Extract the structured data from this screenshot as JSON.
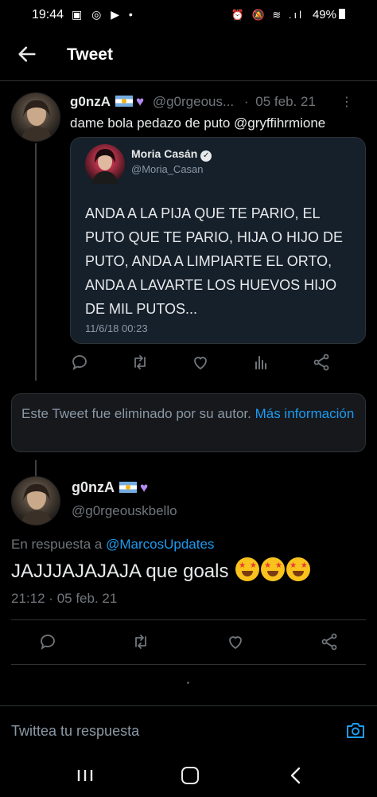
{
  "status_bar": {
    "time": "19:44",
    "notification_icons": "▣ ◎ ▶ •",
    "system_icons": "⏰ 🔕 ≋ .ıl",
    "battery": "49%"
  },
  "header": {
    "title": "Tweet"
  },
  "tweet1": {
    "name": "g0nzA",
    "handle": "@g0rgeous...",
    "separator": "·",
    "date": "05 feb. 21",
    "text": "dame bola pedazo de puto @gryffihrmione",
    "quote": {
      "name": "Moria Casán",
      "handle": "@Moria_Casan",
      "body": "ANDA A LA PIJA QUE TE PARIO, EL PUTO QUE TE PARIO, HIJA O HIJO DE PUTO, ANDA A LIMPIARTE EL ORTO, ANDA A LAVARTE LOS HUEVOS HIJO DE MIL PUTOS...",
      "date": "11/6/18 00:23"
    }
  },
  "deleted_notice": {
    "text": "Este Tweet fue eliminado por su autor.",
    "link": "Más información"
  },
  "tweet2": {
    "name": "g0nzA",
    "handle": "@g0rgeouskbello",
    "reply_prefix": "En respuesta a",
    "reply_to": "@MarcosUpdates",
    "text": "JAJJJAJAJAJA que goals",
    "time": "21:12",
    "separator": "·",
    "date": "05 feb. 21"
  },
  "reply_bar": {
    "placeholder": "Twittea tu respuesta"
  },
  "icons": {
    "back": "arrow-left-icon",
    "reply": "reply-icon",
    "retweet": "retweet-icon",
    "like": "heart-icon",
    "stats": "stats-icon",
    "share": "share-icon",
    "camera": "camera-icon"
  },
  "colors": {
    "background": "#000000",
    "link": "#1d9bf0",
    "muted": "#71767b",
    "quote_card": "#15202b"
  }
}
